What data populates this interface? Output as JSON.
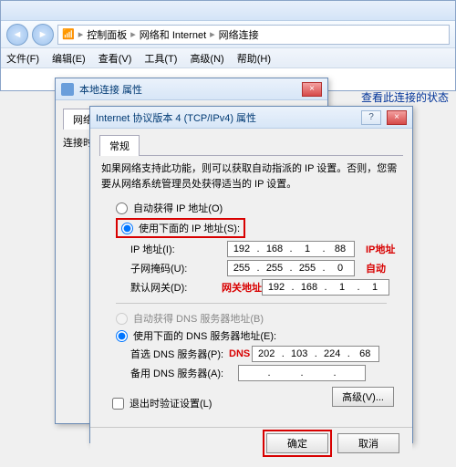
{
  "explorer": {
    "breadcrumbs": [
      "控制面板",
      "网络和 Internet",
      "网络连接"
    ],
    "menu": [
      "文件(F)",
      "编辑(E)",
      "查看(V)",
      "工具(T)",
      "高级(N)",
      "帮助(H)"
    ],
    "right_msg": "查看此连接的状态"
  },
  "dlg1": {
    "title": "本地连接 属性",
    "tab": "网络",
    "partial": "连接时使用:"
  },
  "dlg2": {
    "title": "Internet 协议版本 4 (TCP/IPv4) 属性",
    "help_icon": "?",
    "close_icon": "×",
    "tab": "常规",
    "intro": "如果网络支持此功能，则可以获取自动指派的 IP 设置。否则，您需要从网络系统管理员处获得适当的 IP 设置。",
    "radio_auto_ip": "自动获得 IP 地址(O)",
    "radio_manual_ip": "使用下面的 IP 地址(S):",
    "lbl_ip": "IP 地址(I):",
    "lbl_mask": "子网掩码(U):",
    "lbl_gw": "默认网关(D):",
    "ip": [
      "192",
      "168",
      "1",
      "88"
    ],
    "mask": [
      "255",
      "255",
      "255",
      "0"
    ],
    "gw": [
      "192",
      "168",
      "1",
      "1"
    ],
    "annot_ip": "IP地址",
    "annot_auto": "自动",
    "annot_gw": "网关地址",
    "radio_auto_dns": "自动获得 DNS 服务器地址(B)",
    "radio_manual_dns": "使用下面的 DNS 服务器地址(E):",
    "lbl_dns1": "首选 DNS 服务器(P):",
    "lbl_dns2": "备用 DNS 服务器(A):",
    "dns1": [
      "202",
      "103",
      "224",
      "68"
    ],
    "dns2": [
      "",
      "",
      "",
      ""
    ],
    "annot_dns": "DNS",
    "chk_exit": "退出时验证设置(L)",
    "adv_btn": "高级(V)...",
    "btn_ok": "确定",
    "btn_cancel": "取消"
  }
}
